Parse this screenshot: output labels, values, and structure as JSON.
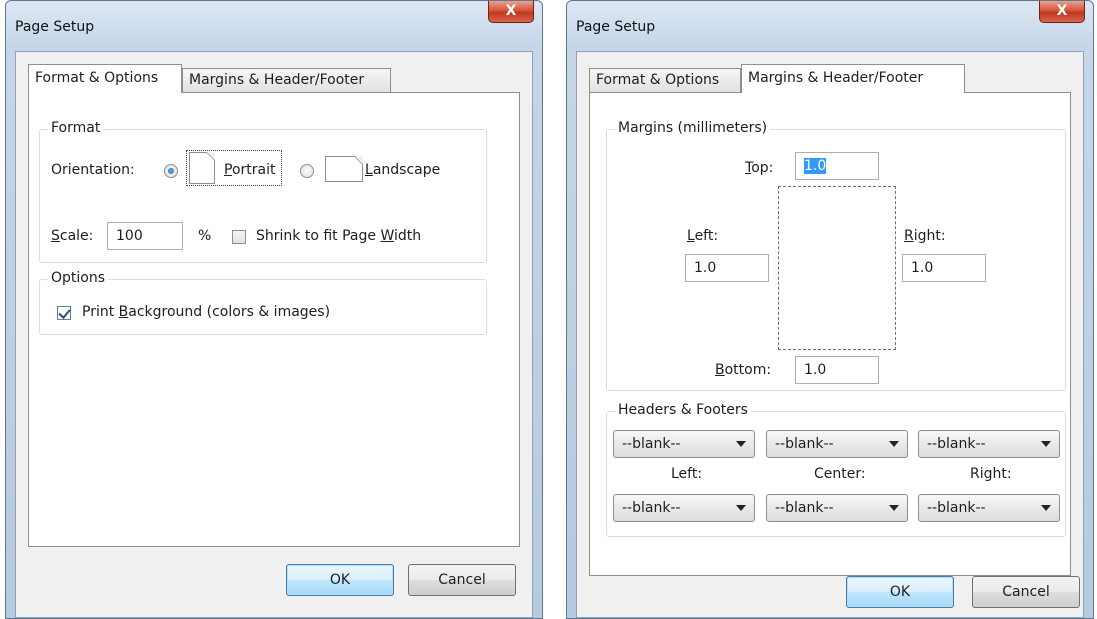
{
  "left_dialog": {
    "title": "Page Setup",
    "close_label": "X",
    "tabs": [
      {
        "label": "Format & Options",
        "active": true
      },
      {
        "label": "Margins & Header/Footer",
        "active": false
      }
    ],
    "format": {
      "legend": "Format",
      "orientation_label": "Orientation:",
      "portrait": {
        "pre": "",
        "key": "P",
        "post": "ortrait",
        "checked": true
      },
      "landscape": {
        "pre": "",
        "key": "L",
        "post": "andscape",
        "checked": false
      },
      "scale": {
        "key": "S",
        "post": "cale:",
        "value": "100",
        "unit": "%"
      },
      "shrink": {
        "pre": "Shrink to fit Page ",
        "key": "W",
        "post": "idth",
        "checked": false
      }
    },
    "options": {
      "legend": "Options",
      "print_background": {
        "pre": "Print ",
        "key": "B",
        "post": "ackground (colors & images)",
        "checked": true
      }
    },
    "ok_label": "OK",
    "cancel_label": "Cancel"
  },
  "right_dialog": {
    "title": "Page Setup",
    "close_label": "X",
    "tabs": [
      {
        "label": "Format & Options",
        "active": false
      },
      {
        "label": "Margins & Header/Footer",
        "active": true
      }
    ],
    "margins": {
      "legend": "Margins (millimeters)",
      "top": {
        "key": "T",
        "post": "op:",
        "value": "1.0"
      },
      "left": {
        "key": "L",
        "post": "eft:",
        "value": "1.0"
      },
      "right": {
        "key": "R",
        "post": "ight:",
        "value": "1.0"
      },
      "bottom": {
        "key": "B",
        "post": "ottom:",
        "value": "1.0"
      }
    },
    "headers_footers": {
      "legend": "Headers & Footers",
      "header_selects": [
        "--blank--",
        "--blank--",
        "--blank--"
      ],
      "column_labels": [
        "Left:",
        "Center:",
        "Right:"
      ],
      "footer_selects": [
        "--blank--",
        "--blank--",
        "--blank--"
      ]
    },
    "ok_label": "OK",
    "cancel_label": "Cancel"
  }
}
